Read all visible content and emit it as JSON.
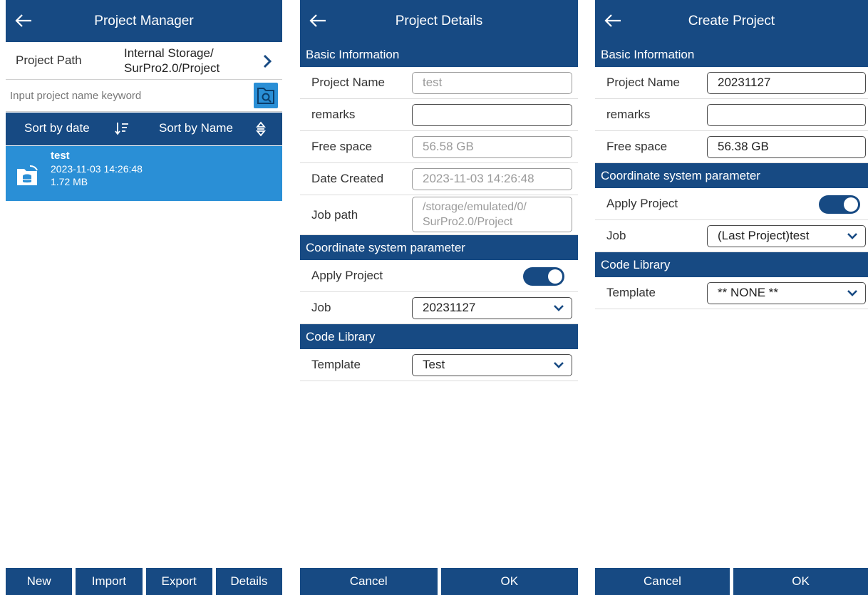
{
  "manager": {
    "title": "Project Manager",
    "path_label": "Project Path",
    "path_line1": "Internal Storage/",
    "path_line2": "SurPro2.0/Project",
    "search_placeholder": "Input project name keyword",
    "sort_by_date": "Sort by date",
    "sort_by_name": "Sort by Name",
    "projects": [
      {
        "name": "test",
        "date": "2023-11-03 14:26:48",
        "size": "1.72 MB"
      }
    ],
    "buttons": {
      "new": "New",
      "import": "Import",
      "export": "Export",
      "details": "Details"
    }
  },
  "details": {
    "title": "Project Details",
    "basic_info": "Basic Information",
    "project_name_label": "Project Name",
    "project_name": "test",
    "remarks_label": "remarks",
    "remarks": "",
    "free_space_label": "Free space",
    "free_space": "56.58 GB",
    "date_created_label": "Date Created",
    "date_created": "2023-11-03 14:26:48",
    "job_path_label": "Job path",
    "job_path_line1": "/storage/emulated/0/",
    "job_path_line2": "SurPro2.0/Project",
    "coord_section": "Coordinate system parameter",
    "apply_project_label": "Apply Project",
    "apply_project_on": true,
    "job_label": "Job",
    "job_value": "20231127",
    "code_library": "Code Library",
    "template_label": "Template",
    "template_value": "Test",
    "cancel": "Cancel",
    "ok": "OK"
  },
  "create": {
    "title": "Create Project",
    "basic_info": "Basic Information",
    "project_name_label": "Project Name",
    "project_name": "20231127",
    "remarks_label": "remarks",
    "remarks": "",
    "free_space_label": "Free space",
    "free_space": "56.38 GB",
    "coord_section": "Coordinate system parameter",
    "apply_project_label": "Apply Project",
    "apply_project_on": true,
    "job_label": "Job",
    "job_value": "(Last Project)test",
    "code_library": "Code Library",
    "template_label": "Template",
    "template_value": "** NONE **",
    "cancel": "Cancel",
    "ok": "OK"
  },
  "colors": {
    "header": "#174a83",
    "selected": "#2a8fd6",
    "text_disabled": "#9a9a9a"
  },
  "icons": [
    "back-arrow-icon",
    "chevron-right-icon",
    "folder-search-icon",
    "sort-descending-icon",
    "sort-updown-icon",
    "project-folder-icon",
    "chevron-down-icon"
  ]
}
